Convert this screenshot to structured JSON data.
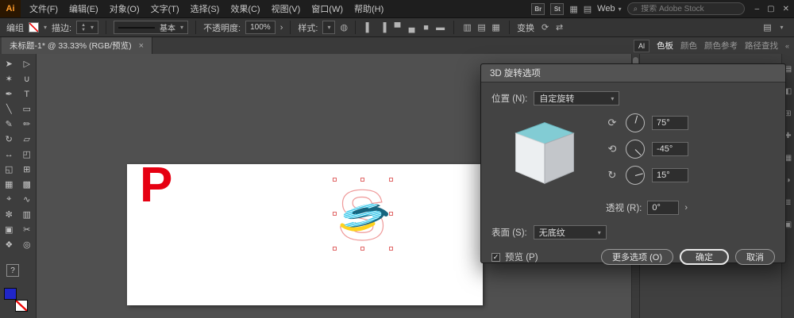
{
  "colors": {
    "accent_red": "#e60012",
    "selection_red": "#ef9a9a",
    "object_cyan": "#2fc6ea",
    "object_yellow": "#ffd21e",
    "object_teal": "#17657f",
    "cube_top": "#82ccd4",
    "fill_blue": "#2026c8"
  },
  "app": {
    "logo": "Ai",
    "minimize": "–",
    "restore": "▢",
    "close": "✕"
  },
  "menubar": {
    "items": [
      "文件(F)",
      "编辑(E)",
      "对象(O)",
      "文字(T)",
      "选择(S)",
      "效果(C)",
      "视图(V)",
      "窗口(W)",
      "帮助(H)"
    ],
    "br_badge": "Br",
    "st_badge": "St",
    "arrange_icon": "▦",
    "layout_icon": "▤",
    "workspace_label": "Web",
    "search_placeholder": "搜索 Adobe Stock"
  },
  "optionsbar": {
    "context_label": "编组",
    "stroke_label": "描边:",
    "brush_name": "基本",
    "opacity_label": "不透明度:",
    "opacity_value": "100%",
    "popup_arrow": "›",
    "style_label": "样式:",
    "doc_icon": "◍",
    "align_icons": [
      "▌",
      "▐",
      "▀",
      "▄",
      "■",
      "▬"
    ],
    "distribute_icons": [
      "▥",
      "▤",
      "▦"
    ],
    "transform_label": "变换",
    "extra_icons": [
      "⟳",
      "⇄"
    ],
    "panel_menu_icon": "▤"
  },
  "tabbar": {
    "doc_title": "未标题-1* @ 33.33% (RGB/预览)",
    "close": "×",
    "al_badge": "Al",
    "panel_tabs": [
      "色板",
      "颜色",
      "颜色参考",
      "路径查找"
    ],
    "collapse_icon": "«"
  },
  "toolbar": {
    "tools": [
      {
        "glyph": "➤"
      },
      {
        "glyph": "▷"
      },
      {
        "glyph": "✶"
      },
      {
        "glyph": "∪"
      },
      {
        "glyph": "✒"
      },
      {
        "glyph": "T"
      },
      {
        "glyph": "╲"
      },
      {
        "glyph": "▭"
      },
      {
        "glyph": "✎"
      },
      {
        "glyph": "✏"
      },
      {
        "glyph": "↻"
      },
      {
        "glyph": "▱"
      },
      {
        "glyph": "↔"
      },
      {
        "glyph": "◰"
      },
      {
        "glyph": "◱"
      },
      {
        "glyph": "⊞"
      },
      {
        "glyph": "▦"
      },
      {
        "glyph": "▩"
      },
      {
        "glyph": "⌖"
      },
      {
        "glyph": "∿"
      },
      {
        "glyph": "✼"
      },
      {
        "glyph": "▥"
      },
      {
        "glyph": "▣"
      },
      {
        "glyph": "✂"
      },
      {
        "glyph": "❖"
      },
      {
        "glyph": "◎"
      }
    ],
    "help_glyph": "?"
  },
  "canvas": {
    "letter": "P",
    "selected_glyph": "S"
  },
  "dialog": {
    "title": "3D 旋转选项",
    "position_label": "位置 (N):",
    "position_value": "自定旋转",
    "dials": [
      {
        "axis": "x",
        "icon": "⟳",
        "value": "75°",
        "deg": 75
      },
      {
        "axis": "y",
        "icon": "⟲",
        "value": "-45°",
        "deg": -45
      },
      {
        "axis": "z",
        "icon": "↻",
        "value": "15°",
        "deg": 15
      }
    ],
    "perspective_label": "透视 (R):",
    "perspective_value": "0°",
    "perspective_arrow": "›",
    "surface_label": "表面 (S):",
    "surface_value": "无底纹",
    "preview_check": "✓",
    "preview_label": "预览 (P)",
    "more_options_btn": "更多选项 (O)",
    "ok_btn": "确定",
    "cancel_btn": "取消"
  },
  "dock": {
    "strip_icons": [
      "▤",
      "◧",
      "⊞",
      "✚",
      "▦",
      "◑",
      "≣",
      "▣"
    ]
  }
}
